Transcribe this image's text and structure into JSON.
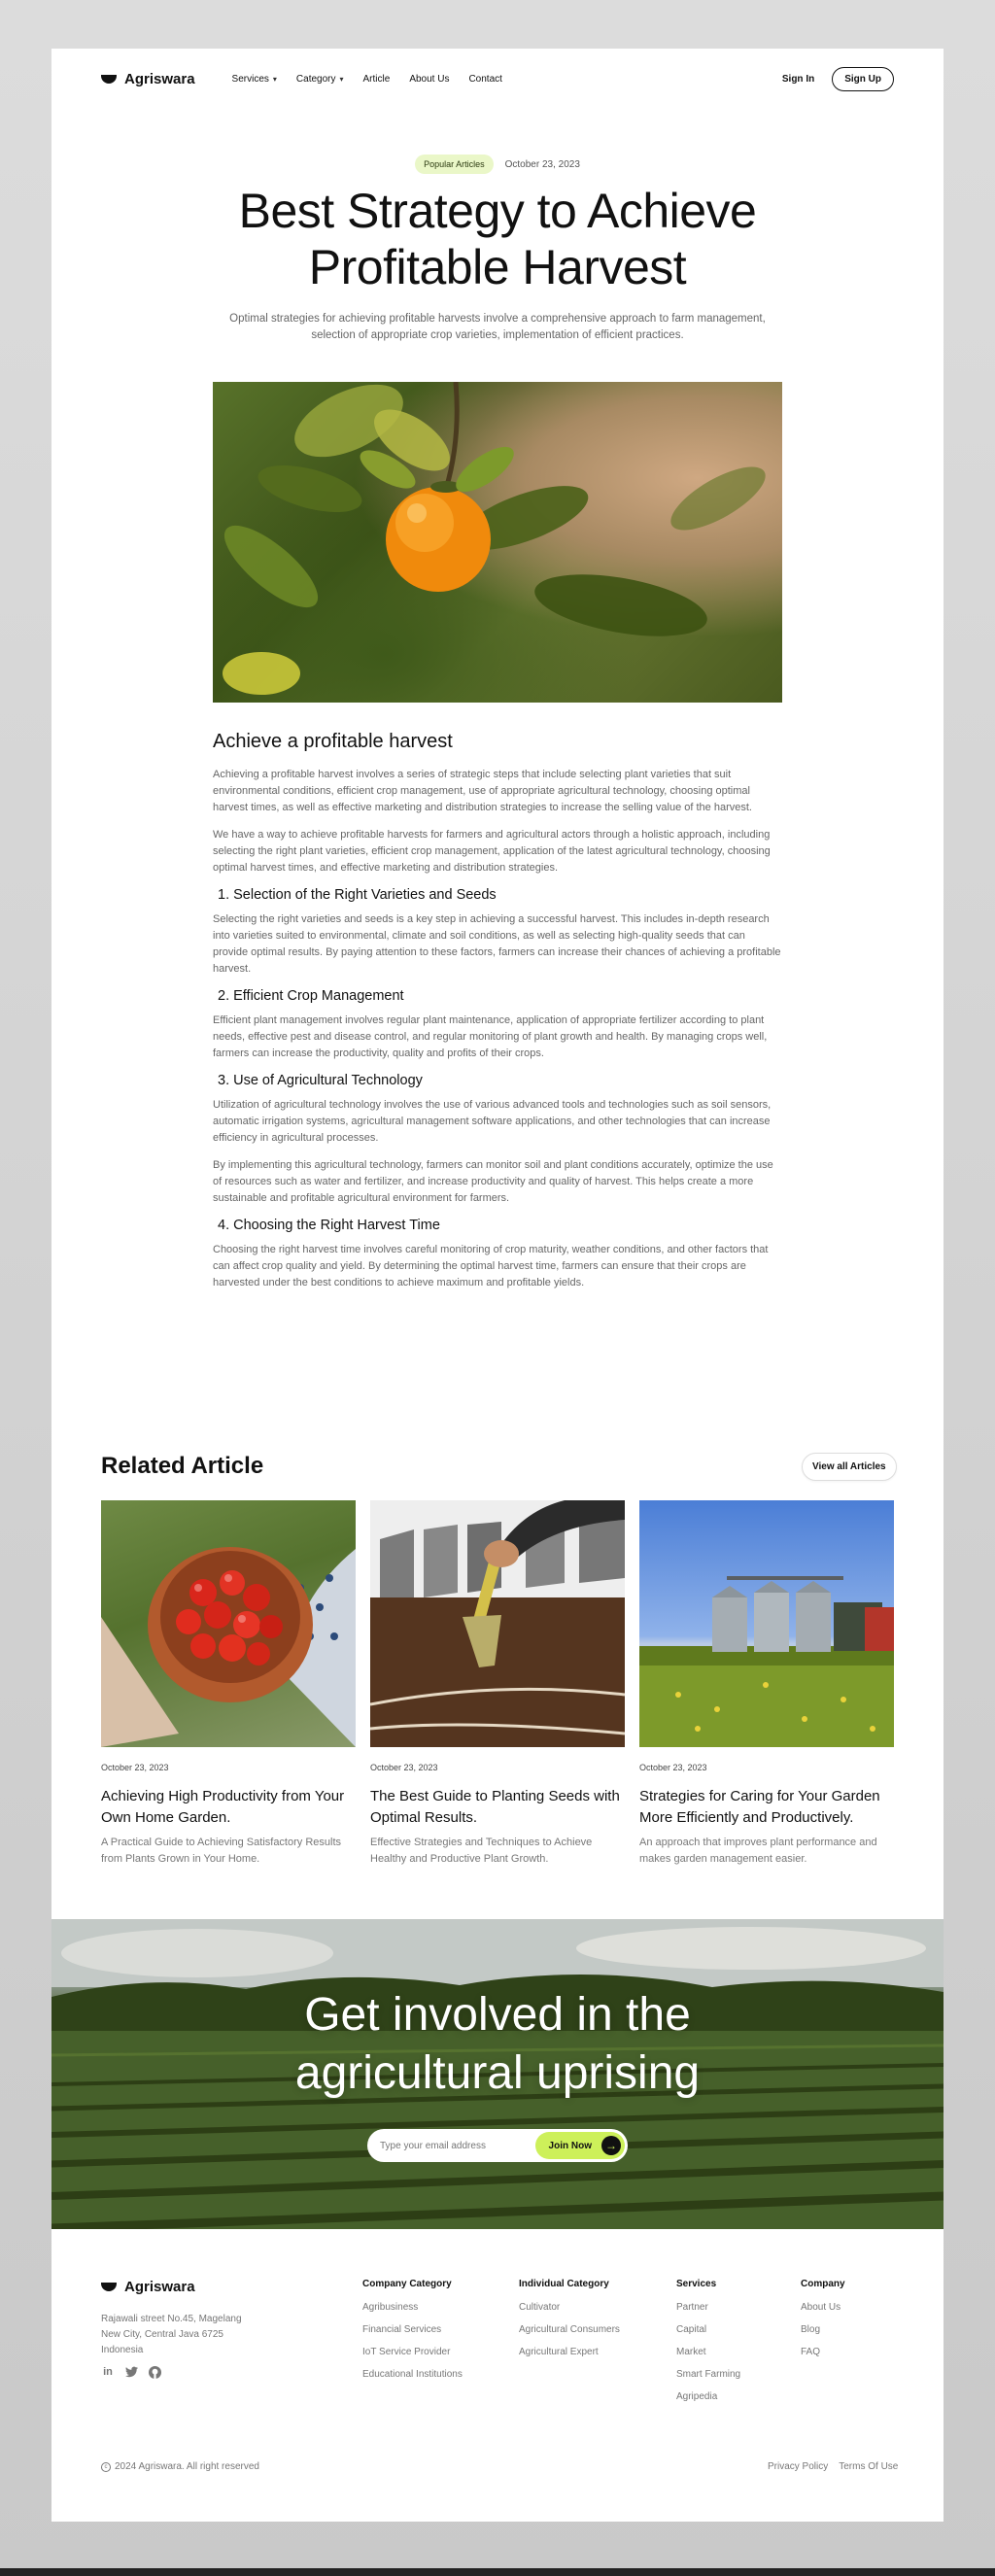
{
  "nav": {
    "brand": "Agriswara",
    "items": [
      {
        "label": "Services",
        "dropdown": true
      },
      {
        "label": "Category",
        "dropdown": true
      },
      {
        "label": "Article",
        "dropdown": false
      },
      {
        "label": "About Us",
        "dropdown": false
      },
      {
        "label": "Contact",
        "dropdown": false
      }
    ],
    "signin": "Sign In",
    "signup": "Sign Up"
  },
  "hero": {
    "tag": "Popular Articles",
    "date": "October 23, 2023",
    "title_line1": "Best Strategy to Achieve",
    "title_line2": "Profitable Harvest",
    "subtitle": "Optimal strategies for achieving profitable harvests involve a comprehensive approach to farm management, selection of appropriate crop varieties, implementation of efficient practices."
  },
  "article": {
    "heading": "Achieve a profitable harvest",
    "intro": [
      "Achieving a profitable harvest involves a series of strategic steps that include selecting plant varieties that suit environmental conditions, efficient crop management, use of appropriate agricultural technology, choosing optimal harvest times, as well as effective marketing and distribution strategies to increase the selling value of the harvest.",
      "We have a way to achieve profitable harvests for farmers and agricultural actors through a holistic approach, including selecting the right plant varieties, efficient crop management, application of the latest agricultural technology, choosing optimal harvest times, and effective marketing and distribution strategies."
    ],
    "sections": [
      {
        "title": "1. Selection of the Right Varieties and Seeds",
        "paragraphs": [
          "Selecting the right varieties and seeds is a key step in achieving a successful harvest. This includes in-depth research into varieties suited to environmental, climate and soil conditions, as well as selecting high-quality seeds that can provide optimal results. By paying attention to these factors, farmers can increase their chances of achieving a profitable harvest."
        ]
      },
      {
        "title": "2. Efficient Crop Management",
        "paragraphs": [
          "Efficient plant management involves regular plant maintenance, application of appropriate fertilizer according to plant needs, effective pest and disease control, and regular monitoring of plant growth and health. By managing crops well, farmers can increase the productivity, quality and profits of their crops."
        ]
      },
      {
        "title": "3. Use of Agricultural Technology",
        "paragraphs": [
          "Utilization of agricultural technology involves the use of various advanced tools and technologies such as soil sensors, automatic irrigation systems, agricultural management software applications, and other technologies that can increase efficiency in agricultural processes.",
          " By implementing this agricultural technology, farmers can monitor soil and plant conditions accurately, optimize the use of resources such as water and fertilizer, and increase productivity and quality of harvest. This helps create a more sustainable and profitable agricultural environment for farmers."
        ]
      },
      {
        "title": "4. Choosing the Right Harvest Time",
        "paragraphs": [
          "Choosing the right harvest time involves careful monitoring of crop maturity, weather conditions, and other factors that can affect crop quality and yield. By determining the optimal harvest time, farmers can ensure that their crops are harvested under the best conditions to achieve maximum and profitable yields."
        ]
      }
    ]
  },
  "related": {
    "title": "Related Article",
    "view_all": "View all Articles",
    "cards": [
      {
        "date": "October 23, 2023",
        "title": "Achieving High Productivity from Your Own Home Garden.",
        "desc": "A Practical Guide to Achieving Satisfactory Results from Plants Grown in Your Home."
      },
      {
        "date": "October 23, 2023",
        "title": "The Best Guide to Planting Seeds with Optimal Results.",
        "desc": "Effective Strategies and Techniques to Achieve Healthy and Productive Plant Growth."
      },
      {
        "date": "October 23, 2023",
        "title": "Strategies for Caring for Your Garden More Efficiently and Productively.",
        "desc": "An approach that improves plant performance and makes garden management easier."
      }
    ]
  },
  "cta": {
    "title_line1": "Get involved in the",
    "title_line2": "agricultural uprising",
    "placeholder": "Type your email address",
    "button": "Join Now"
  },
  "footer": {
    "brand": "Agriswara",
    "address": [
      "Rajawali street No.45, Magelang",
      "New City, Central Java 6725",
      "Indonesia"
    ],
    "social": [
      "linkedin-icon",
      "twitter-icon",
      "github-icon"
    ],
    "columns": [
      {
        "title": "Company Category",
        "links": [
          "Agribusiness",
          "Financial Services",
          "IoT Service Provider",
          "Educational Institutions"
        ]
      },
      {
        "title": "Individual Category",
        "links": [
          "Cultivator",
          "Agricultural Consumers",
          "Agricultural Expert"
        ]
      },
      {
        "title": "Services",
        "links": [
          "Partner",
          "Capital",
          "Market",
          "Smart Farming",
          "Agripedia"
        ]
      },
      {
        "title": "Company",
        "links": [
          "About Us",
          "Blog",
          "FAQ"
        ]
      }
    ],
    "copyright": "2024 Agriswara. All right reserved",
    "legal": [
      "Privacy Policy",
      "Terms Of Use"
    ]
  }
}
